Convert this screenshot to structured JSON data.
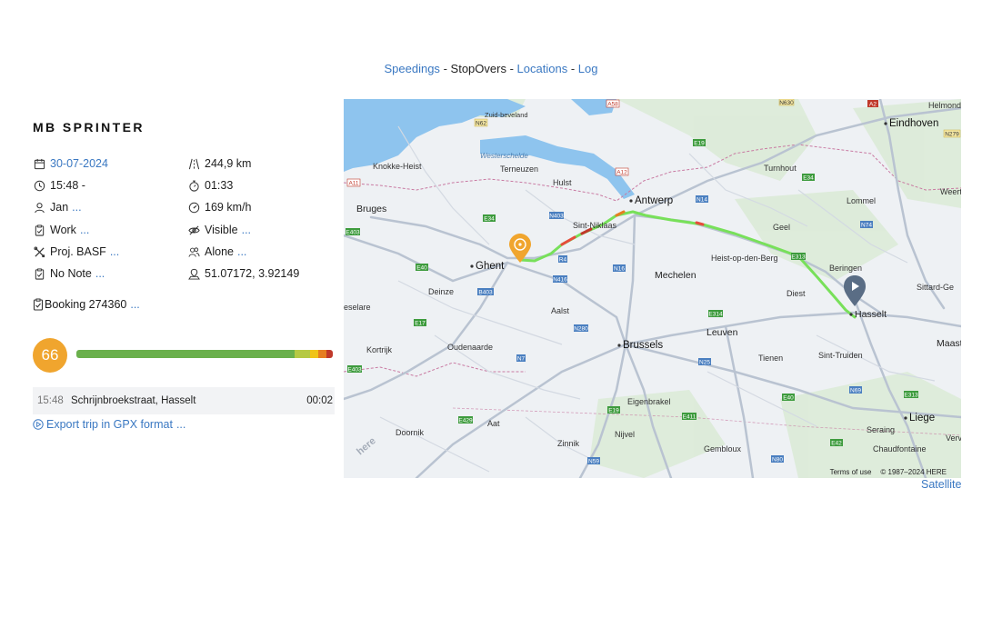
{
  "nav": {
    "speedings": "Speedings",
    "stopovers": "StopOvers",
    "locations": "Locations",
    "log": "Log",
    "separator": "-"
  },
  "vehicle": {
    "title": "MB SPRINTER"
  },
  "details": {
    "date": "30-07-2024",
    "time": "15:48 -",
    "driver": "Jan",
    "category": "Work",
    "project": "Proj. BASF",
    "note": "No Note",
    "distance": "244,9 km",
    "duration": "01:33",
    "max_speed": "169 km/h",
    "visibility": "Visible",
    "company": "Alone",
    "coordinates": "51.07172, 3.92149",
    "more": "..."
  },
  "booking": {
    "label": "Booking 274360",
    "more": "..."
  },
  "score": {
    "value": "66",
    "bar": [
      {
        "fraction": 0.85,
        "color": "#6ab04c"
      },
      {
        "fraction": 0.06,
        "color": "#b5c944"
      },
      {
        "fraction": 0.035,
        "color": "#f0c419"
      },
      {
        "fraction": 0.03,
        "color": "#e67e22"
      },
      {
        "fraction": 0.025,
        "color": "#c0392b"
      }
    ]
  },
  "stopover": {
    "time": "15:48",
    "address": "Schrijnbroekstraat, Hasselt",
    "duration": "00:02"
  },
  "export": {
    "label": "Export trip in GPX format",
    "more": "..."
  },
  "map": {
    "cities": [
      "Eindhoven",
      "Helmond",
      "Antwerp",
      "Ghent",
      "Brussels",
      "Mechelen",
      "Leuven",
      "Hasselt",
      "Liege",
      "Maast",
      "Bruges",
      "Knokke-Heist",
      "Terneuzen",
      "Hulst",
      "Sint-Niklaas",
      "Turnhout",
      "Geel",
      "Lommel",
      "Weert",
      "Heist-op-den-Berg",
      "Beringen",
      "Sittard-Ge",
      "Diest",
      "Aalst",
      "Deinze",
      "Oudenaarde",
      "Kortrijk",
      "eselare",
      "Tienen",
      "Sint-Truiden",
      "Eigenbrakel",
      "Nijvel",
      "Zinnik",
      "Aat",
      "Doornik",
      "Gembloux",
      "Seraing",
      "Chaudfontaine",
      "Verv",
      "Westerschelde",
      "Zuid-beveland"
    ],
    "roads": [
      "A58",
      "N630",
      "A2",
      "N279",
      "N62",
      "E19",
      "A12",
      "E34",
      "N14",
      "E313",
      "N74",
      "E403",
      "N403",
      "E40",
      "N416",
      "N16",
      "R4",
      "B403",
      "E17",
      "N280",
      "E314",
      "N25",
      "N69",
      "E313",
      "N7",
      "E429",
      "E42",
      "E411",
      "N59",
      "N80",
      "N43",
      "A11",
      "E314",
      "A16"
    ],
    "terms": "Terms of use",
    "copyright": "© 1987–2024 HERE",
    "logo": "here",
    "satellite": "Satellite"
  }
}
